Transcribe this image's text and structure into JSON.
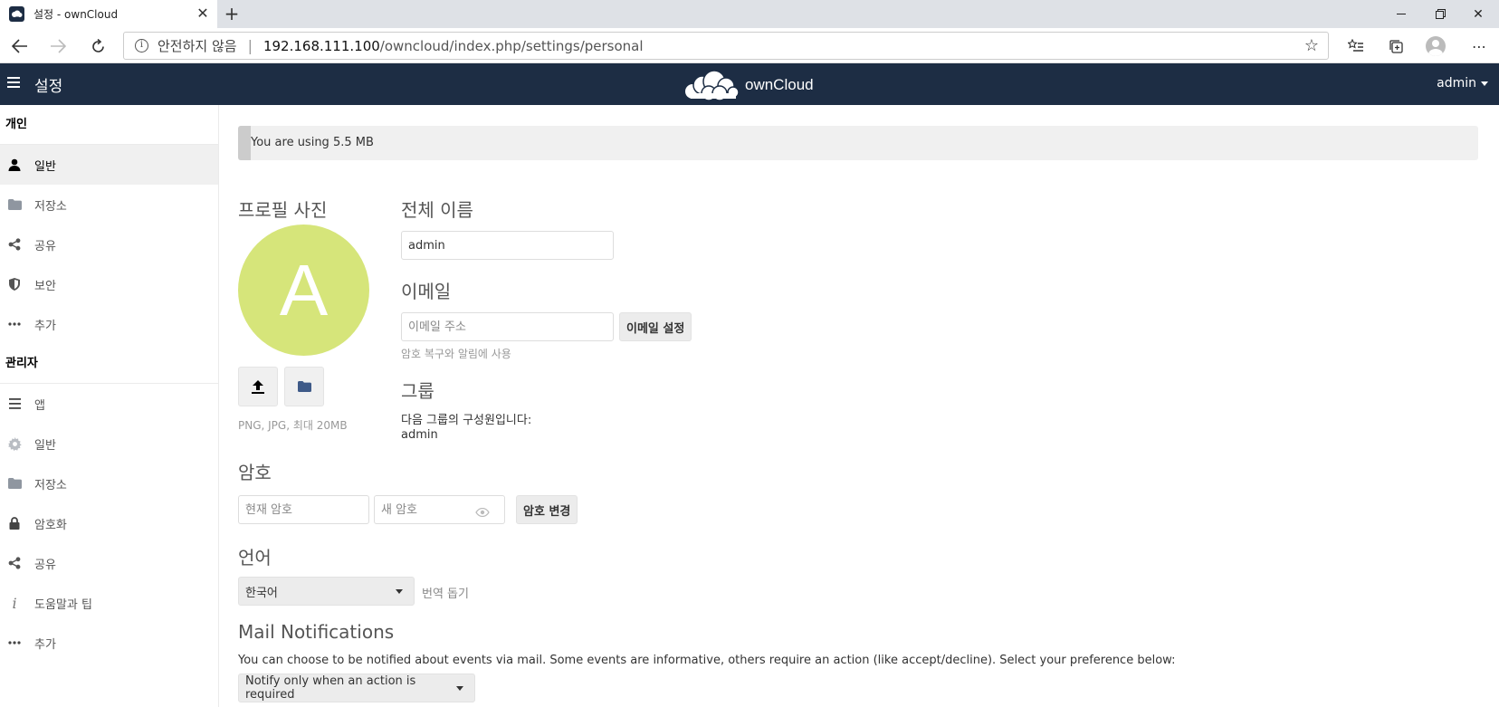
{
  "browser": {
    "tab_title": "설정 - ownCloud",
    "url_security": "안전하지 않음",
    "url_host": "192.168.111.100",
    "url_path": "/owncloud/index.php/settings/personal"
  },
  "header": {
    "app_title": "설정",
    "logo_text": "ownCloud",
    "user": "admin"
  },
  "sidebar": {
    "personal_title": "개인",
    "personal_items": [
      {
        "label": "일반",
        "icon": "person-icon",
        "active": true
      },
      {
        "label": "저장소",
        "icon": "folder-icon"
      },
      {
        "label": "공유",
        "icon": "share-icon"
      },
      {
        "label": "보안",
        "icon": "shield-icon"
      },
      {
        "label": "추가",
        "icon": "more-icon"
      }
    ],
    "admin_title": "관리자",
    "admin_items": [
      {
        "label": "앱",
        "icon": "list-icon"
      },
      {
        "label": "일반",
        "icon": "gear-icon"
      },
      {
        "label": "저장소",
        "icon": "folder-icon"
      },
      {
        "label": "암호화",
        "icon": "lock-icon"
      },
      {
        "label": "공유",
        "icon": "share-icon"
      },
      {
        "label": "도움말과 팁",
        "icon": "info-icon"
      },
      {
        "label": "추가",
        "icon": "more-icon"
      }
    ]
  },
  "quota": {
    "text": "You are using 5.5 MB",
    "fill_fraction": 0.01
  },
  "profile": {
    "title": "프로필 사진",
    "avatar_letter": "A",
    "avatar_color": "#d6e57a",
    "hint": "PNG, JPG, 최대 20MB"
  },
  "fullname": {
    "title": "전체 이름",
    "value": "admin"
  },
  "email": {
    "title": "이메일",
    "placeholder": "이메일 주소",
    "button": "이메일 설정",
    "hint": "암호 복구와 알림에 사용"
  },
  "groups": {
    "title": "그룹",
    "desc": "다음 그룹의 구성원입니다:",
    "value": "admin"
  },
  "password": {
    "title": "암호",
    "current_placeholder": "현재 암호",
    "new_placeholder": "새 암호",
    "button": "암호 변경"
  },
  "language": {
    "title": "언어",
    "selected": "한국어",
    "help_link": "번역 돕기"
  },
  "mail": {
    "title": "Mail Notifications",
    "desc": "You can choose to be notified about events via mail. Some events are informative, others require an action (like accept/decline). Select your preference below:",
    "selected": "Notify only when an action is required"
  },
  "colors": {
    "header_bg": "#1d2d44"
  }
}
